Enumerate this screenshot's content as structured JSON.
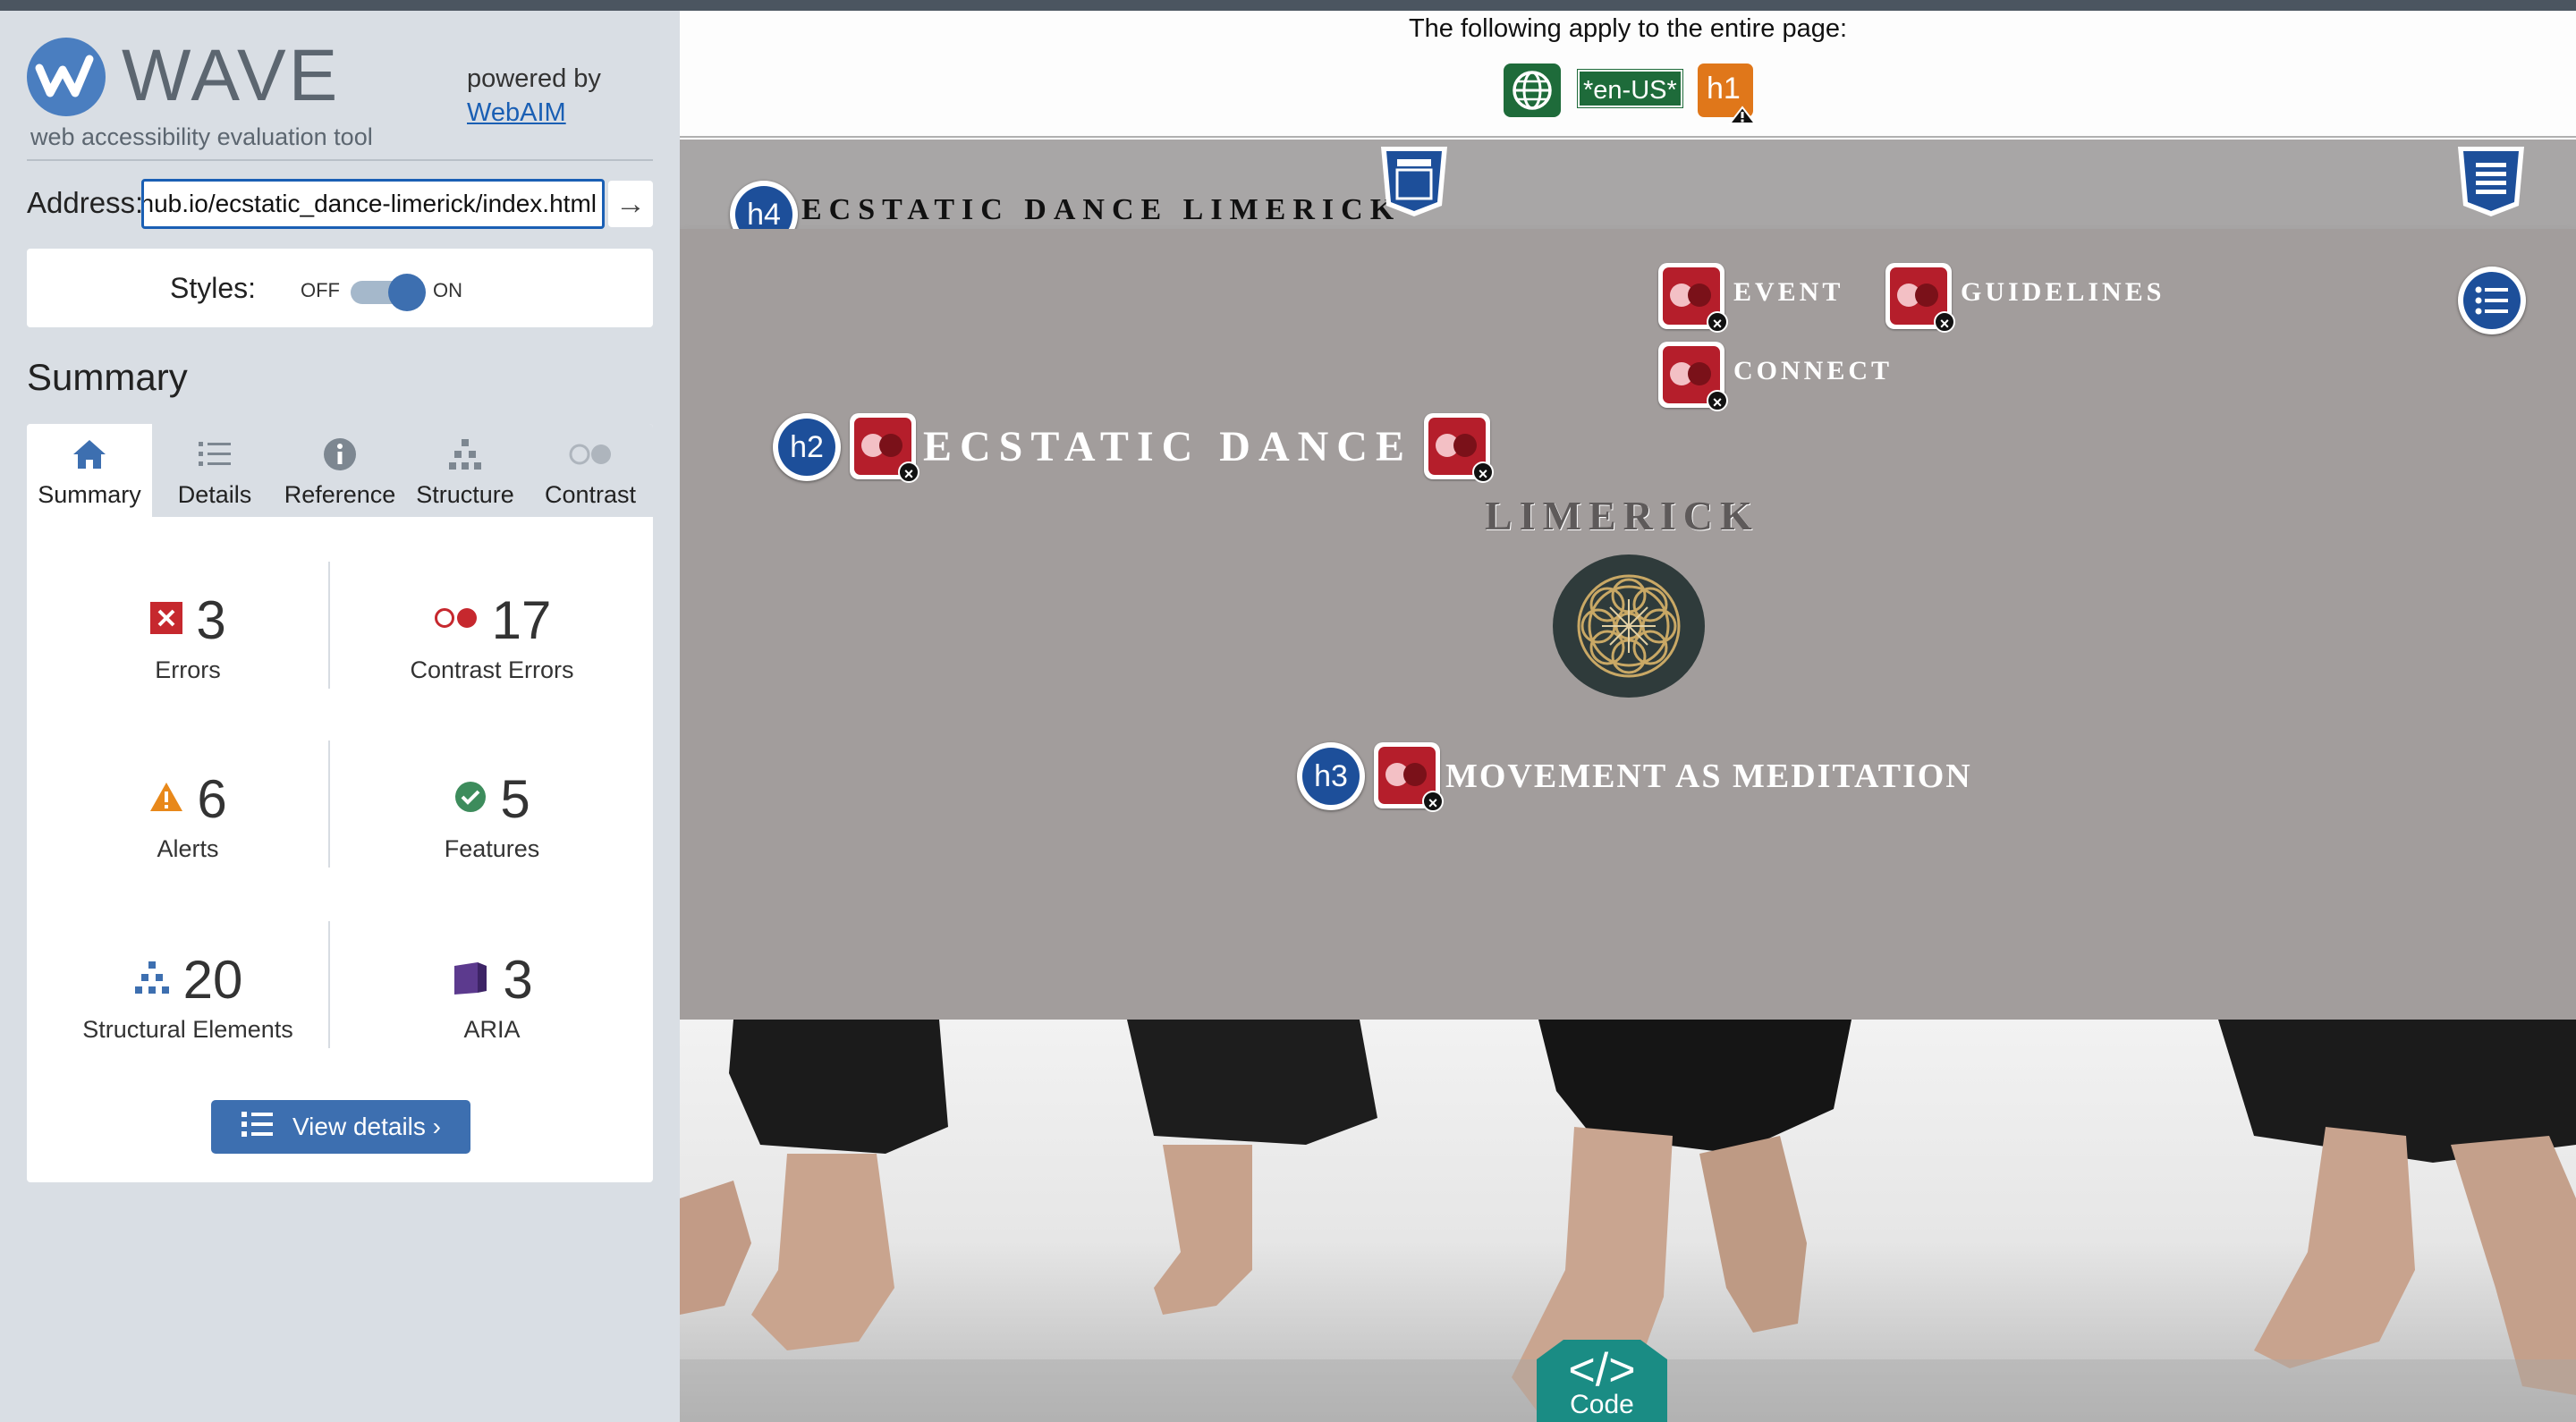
{
  "wave": {
    "title": "WAVE",
    "subtitle": "web accessibility evaluation tool",
    "powered_by": "powered by",
    "webaim_link": "WebAIM"
  },
  "address": {
    "label": "Address:",
    "value": "jithub.io/ecstatic_dance-limerick/index.html"
  },
  "styles": {
    "label": "Styles:",
    "off": "OFF",
    "on": "ON",
    "state": "on"
  },
  "summary": {
    "heading": "Summary",
    "tabs": [
      {
        "label": "Summary",
        "icon": "home-icon",
        "active": true
      },
      {
        "label": "Details",
        "icon": "list-icon",
        "active": false
      },
      {
        "label": "Reference",
        "icon": "info-icon",
        "active": false
      },
      {
        "label": "Structure",
        "icon": "sitemap-icon",
        "active": false
      },
      {
        "label": "Contrast",
        "icon": "contrast-icon",
        "active": false
      }
    ],
    "stats": [
      {
        "count": "3",
        "label": "Errors",
        "icon": "error-icon",
        "color": "#c6282e"
      },
      {
        "count": "17",
        "label": "Contrast Errors",
        "icon": "contrast-error-icon",
        "color": "#c6282e"
      },
      {
        "count": "6",
        "label": "Alerts",
        "icon": "alert-icon",
        "color": "#e8881a"
      },
      {
        "count": "5",
        "label": "Features",
        "icon": "feature-icon",
        "color": "#3d8c5c"
      },
      {
        "count": "20",
        "label": "Structural Elements",
        "icon": "structure-icon",
        "color": "#3d6fb0"
      },
      {
        "count": "3",
        "label": "ARIA",
        "icon": "aria-icon",
        "color": "#5c3a8e"
      }
    ],
    "view_details": "View details ›"
  },
  "page_info": {
    "title": "The following apply to the entire page:",
    "language_tag": "*en-US*",
    "h1_badge": "h1"
  },
  "site": {
    "title": "ECSTATIC DANCE LIMERICK",
    "h4_badge": "h4",
    "nav": [
      "EVENT",
      "GUIDELINES",
      "CONNECT"
    ],
    "h2_badge": "h2",
    "hero_line1": "ECSTATIC DANCE",
    "hero_line2": "LIMERICK",
    "h3_badge": "h3",
    "tagline": "MOVEMENT AS MEDITATION",
    "code_tab": "Code"
  },
  "colors": {
    "accent": "#3d6fb0",
    "error": "#c6282e",
    "sidebar_bg": "#d9dee4",
    "page_bg": "#a29d9c"
  }
}
